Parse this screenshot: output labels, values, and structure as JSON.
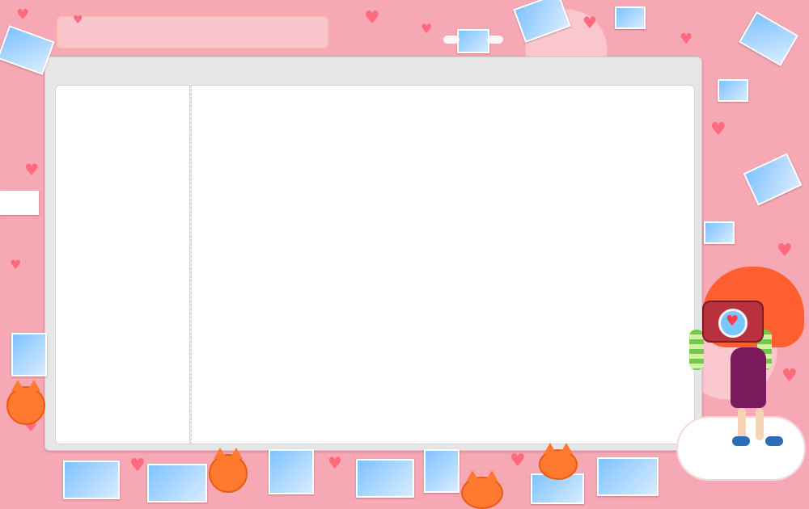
{
  "window": {
    "title": ""
  },
  "layout": {
    "sidebar": {
      "items": []
    },
    "content": {
      "blocks": []
    }
  },
  "decor": {
    "hearts": [
      "heart-icon"
    ],
    "photos": [
      "photo-icon"
    ],
    "characters": [
      "cat-icon",
      "girl-with-camera-icon",
      "cloud-icon"
    ]
  }
}
